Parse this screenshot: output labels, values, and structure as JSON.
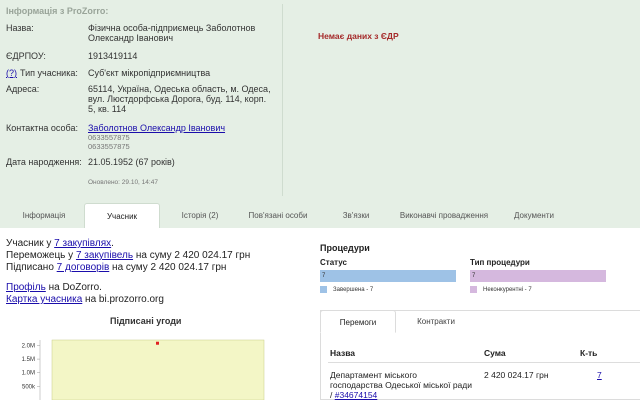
{
  "info": {
    "title": "Інформація з ProZorro:",
    "rows": {
      "name": {
        "label": "Назва:",
        "lines": [
          "Фізична особа-підприємець Заболотнов",
          "Олександр Іванович"
        ]
      },
      "edrpou": {
        "label": "ЄДРПОУ:",
        "value": "1913419114"
      },
      "type": {
        "label": "Тип учасника:",
        "help": "(?)",
        "value": "Суб'єкт мікропідприємництва"
      },
      "address": {
        "label": "Адреса:",
        "lines": [
          "65114, Україна, Одеська область, м. Одеса,",
          "вул. Люстдорфська Дорога, буд. 114, корп.",
          "5, кв. 114"
        ]
      },
      "contact": {
        "label": "Контактна особа:",
        "link": "Заболотнов Олександр Іванович",
        "phones": [
          "0633557875",
          "0633557875"
        ]
      },
      "birth": {
        "label": "Дата народження:",
        "value": "21.05.1952 (67 років)"
      }
    },
    "updated": "Оновлено: 29.10, 14:47",
    "edr_message": "Немає даних з ЄДР"
  },
  "tabs": [
    "Інформація",
    "Учасник",
    "Історія (2)",
    "Пов'язані особи",
    "Зв'язки",
    "Виконавчі провадження",
    "Документи"
  ],
  "participant": {
    "l1_a": "Учасник у ",
    "l1_link": "7 закупівлях",
    "l1_b": ".",
    "l2_a": "Переможець у ",
    "l2_link": "7 закупівель",
    "l2_b": " на суму 2 420 024.17 грн",
    "l3_a": "Підписано ",
    "l3_link": "7 договорів",
    "l3_b": " на суму 2 420 024.17 грн",
    "l4_link": "Профіль",
    "l4_b": " на DoZorro.",
    "l5_link": "Картка учасника",
    "l5_b": " на bi.prozorro.org"
  },
  "chart_data": {
    "type": "scatter",
    "title": "Підписані угоди",
    "y_ticks": [
      "2.0M",
      "1.5M",
      "1.0M",
      "500k"
    ],
    "points": [
      {
        "y": 2100000
      }
    ],
    "ylim": [
      0,
      2200000
    ]
  },
  "procedures": {
    "title": "Процедури",
    "status_label": "Статус",
    "status_bar": "7",
    "status_legend": "Завершена - 7",
    "type_label": "Тип процедури",
    "type_bar": "7",
    "type_legend": "Неконкурентні - 7",
    "colors": {
      "status": "#9ec2e6",
      "status_swatch": "#9ec2e6",
      "type": "#d5b8de",
      "type_swatch": "#d5b8de"
    }
  },
  "wins": {
    "tabs": [
      "Перемоги",
      "Контракти"
    ],
    "headers": [
      "Назва",
      "Сума",
      "К-ть"
    ],
    "row": {
      "name_lines": [
        "Департамент міського",
        "господарства Одеської міської ради"
      ],
      "name_link": "#34674154",
      "sum": "2 420 024.17 грн",
      "count": "7"
    }
  }
}
